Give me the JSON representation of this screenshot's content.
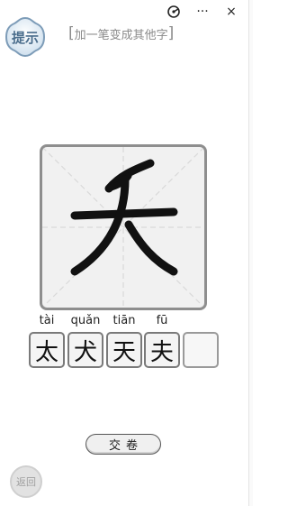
{
  "header": {
    "hint_label": "提示",
    "prompt": "加一笔变成其他字",
    "controls": [
      "mini-program-target-icon",
      "more-icon",
      "close-icon"
    ],
    "more_symbol": "···",
    "close_symbol": "×"
  },
  "puzzle": {
    "character": "夭",
    "answers": [
      {
        "pinyin": "tài",
        "char": "太"
      },
      {
        "pinyin": "quǎn",
        "char": "犬"
      },
      {
        "pinyin": "tiān",
        "char": "天"
      },
      {
        "pinyin": "fū",
        "char": "夫"
      },
      {
        "pinyin": "",
        "char": ""
      }
    ]
  },
  "footer": {
    "submit_label": "交卷",
    "back_label": "返回"
  },
  "colors": {
    "hint_blue": "#4a6d8c",
    "box_border": "#8e8e8e",
    "grid_line": "#d9d9d9"
  }
}
